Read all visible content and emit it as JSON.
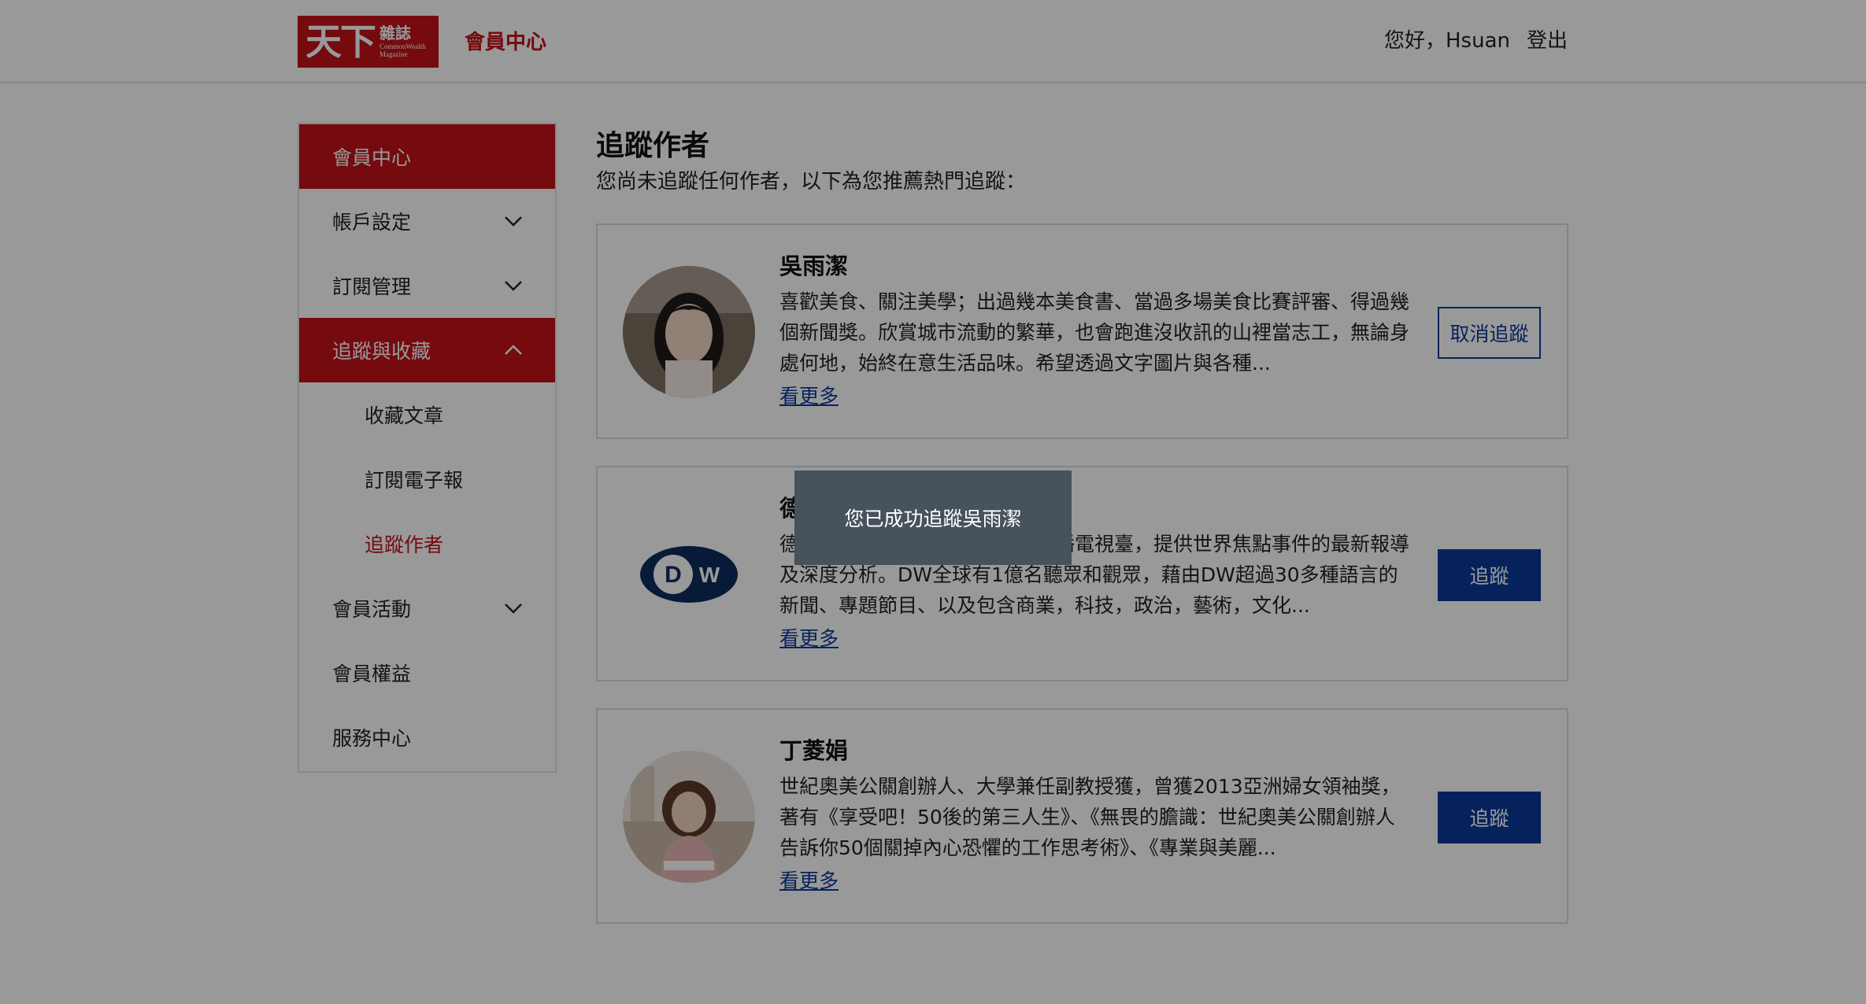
{
  "header": {
    "logo_main": "天下",
    "logo_zh": "雜誌",
    "logo_en_1": "CommonWealth",
    "logo_en_2": "Magazine",
    "title": "會員中心",
    "greeting": "您好，Hsuan",
    "logout": "登出"
  },
  "sidebar": {
    "items": [
      {
        "label": "會員中心"
      },
      {
        "label": "帳戶設定"
      },
      {
        "label": "訂閱管理"
      },
      {
        "label": "追蹤與收藏"
      },
      {
        "label": "收藏文章"
      },
      {
        "label": "訂閱電子報"
      },
      {
        "label": "追蹤作者"
      },
      {
        "label": "會員活動"
      },
      {
        "label": "會員權益"
      },
      {
        "label": "服務中心"
      }
    ]
  },
  "main": {
    "title": "追蹤作者",
    "subtitle": "您尚未追蹤任何作者，以下為您推薦熱門追蹤：",
    "see_more": "看更多",
    "authors": [
      {
        "name": "吳雨潔",
        "desc": "喜歡美食、關注美學；出過幾本美食書、當過多場美食比賽評審、得過幾個新聞獎。欣賞城市流動的繁華，也會跑進沒收訊的山裡當志工，無論身處何地，始終在意生活品味。希望透過文字圖片與各種...",
        "button": "取消追蹤"
      },
      {
        "name": "德",
        "desc": "德　　　　　　　　　　　　　播電視臺，提供世界焦點事件的最新報導及深度分析。DW全球有1億名聽眾和觀眾，藉由DW超過30多種語言的新聞、專題節目、以及包含商業，科技，政治，藝術，文化...",
        "button": "追蹤",
        "logo_text": "DW"
      },
      {
        "name": "丁菱娟",
        "desc": "世紀奧美公關創辦人、大學兼任副教授獲，曾獲2013亞洲婦女領袖獎，著有《享受吧！50後的第三人生》、《無畏的膽識：世紀奧美公關創辦人告訴你50個關掉內心恐懼的工作思考術》、《專業與美麗...",
        "button": "追蹤"
      }
    ]
  },
  "toast": {
    "message": "您已成功追蹤吳雨潔"
  },
  "colors": {
    "brand_red": "#c4111a",
    "link_blue": "#0b3a9a",
    "overlay": "rgba(0,0,0,0.4)",
    "toast_bg": "#46525c"
  }
}
